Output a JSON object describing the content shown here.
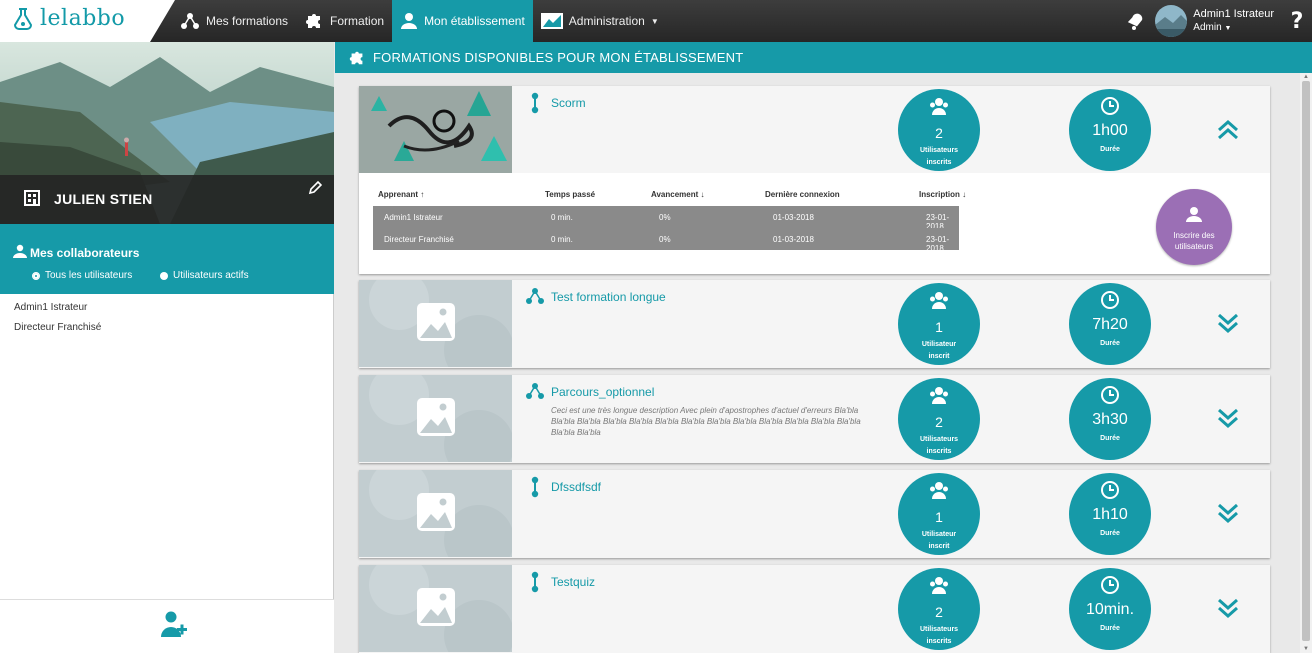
{
  "app": {
    "logo_text": "lelabbo"
  },
  "nav": {
    "items": [
      {
        "label": "Mes formations",
        "icon": "hierarchy-icon"
      },
      {
        "label": "Formation",
        "icon": "puzzle-icon"
      },
      {
        "label": "Mon établissement",
        "icon": "user-icon",
        "active": true
      },
      {
        "label": "Administration",
        "icon": "chart-icon",
        "dropdown": true
      }
    ]
  },
  "user": {
    "name": "Admin1 Istrateur",
    "role": "Admin",
    "help": "?"
  },
  "sidebar": {
    "person_name": "JULIEN STIEN",
    "collab_title": "Mes collaborateurs",
    "filter_all": "Tous les utilisateurs",
    "filter_active": "Utilisateurs actifs",
    "users": [
      "Admin1 Istrateur",
      "Directeur Franchisé"
    ]
  },
  "main": {
    "title": "FORMATIONS DISPONIBLES POUR MON ÉTABLISSEMENT",
    "courses": [
      {
        "title": "Scorm",
        "icon": "scorm-icon",
        "desc": "",
        "users": "2",
        "users_label_1": "Utilisateurs",
        "users_label_2": "inscrits",
        "duration": "1h00",
        "duration_label": "Durée",
        "expanded": true
      },
      {
        "title": "Test formation longue",
        "icon": "parcours-icon",
        "desc": "",
        "users": "1",
        "users_label_1": "Utilisateur",
        "users_label_2": "inscrit",
        "duration": "7h20",
        "duration_label": "Durée",
        "expanded": false
      },
      {
        "title": "Parcours_optionnel",
        "icon": "parcours-icon",
        "desc": "Ceci est une très longue description Avec plein d'apostrophes d'actuel d'erreurs Bla'bla Bla'bla Bla'bla Bla'bla Bla'bla Bla'bla Bla'bla Bla'bla Bla'bla Bla'bla Bla'bla Bla'bla Bla'bla Bla'bla Bla'bla",
        "users": "2",
        "users_label_1": "Utilisateurs",
        "users_label_2": "inscrits",
        "duration": "3h30",
        "duration_label": "Durée",
        "expanded": false
      },
      {
        "title": "Dfssdfsdf",
        "icon": "scorm-icon",
        "desc": "",
        "users": "1",
        "users_label_1": "Utilisateur",
        "users_label_2": "inscrit",
        "duration": "1h10",
        "duration_label": "Durée",
        "expanded": false
      },
      {
        "title": "Testquiz",
        "icon": "scorm-icon",
        "desc": "",
        "users": "2",
        "users_label_1": "Utilisateurs",
        "users_label_2": "inscrits",
        "duration": "10min.",
        "duration_label": "Durée",
        "expanded": false
      }
    ],
    "table": {
      "headers": [
        "Apprenant ↑",
        "Temps passé",
        "Avancement ↓",
        "Dernière connexion",
        "Inscription ↓"
      ],
      "rows": [
        [
          "Admin1 Istrateur",
          "0 min.",
          "0%",
          "01-03-2018",
          "23-01-2018"
        ],
        [
          "Directeur Franchisé",
          "0 min.",
          "0%",
          "01-03-2018",
          "23-01-2018"
        ]
      ],
      "enroll_label_1": "Inscrire des",
      "enroll_label_2": "utilisateurs"
    }
  },
  "colors": {
    "teal": "#169aa8",
    "purple": "#9b6fb5",
    "topbar": "#2e2e2e"
  }
}
